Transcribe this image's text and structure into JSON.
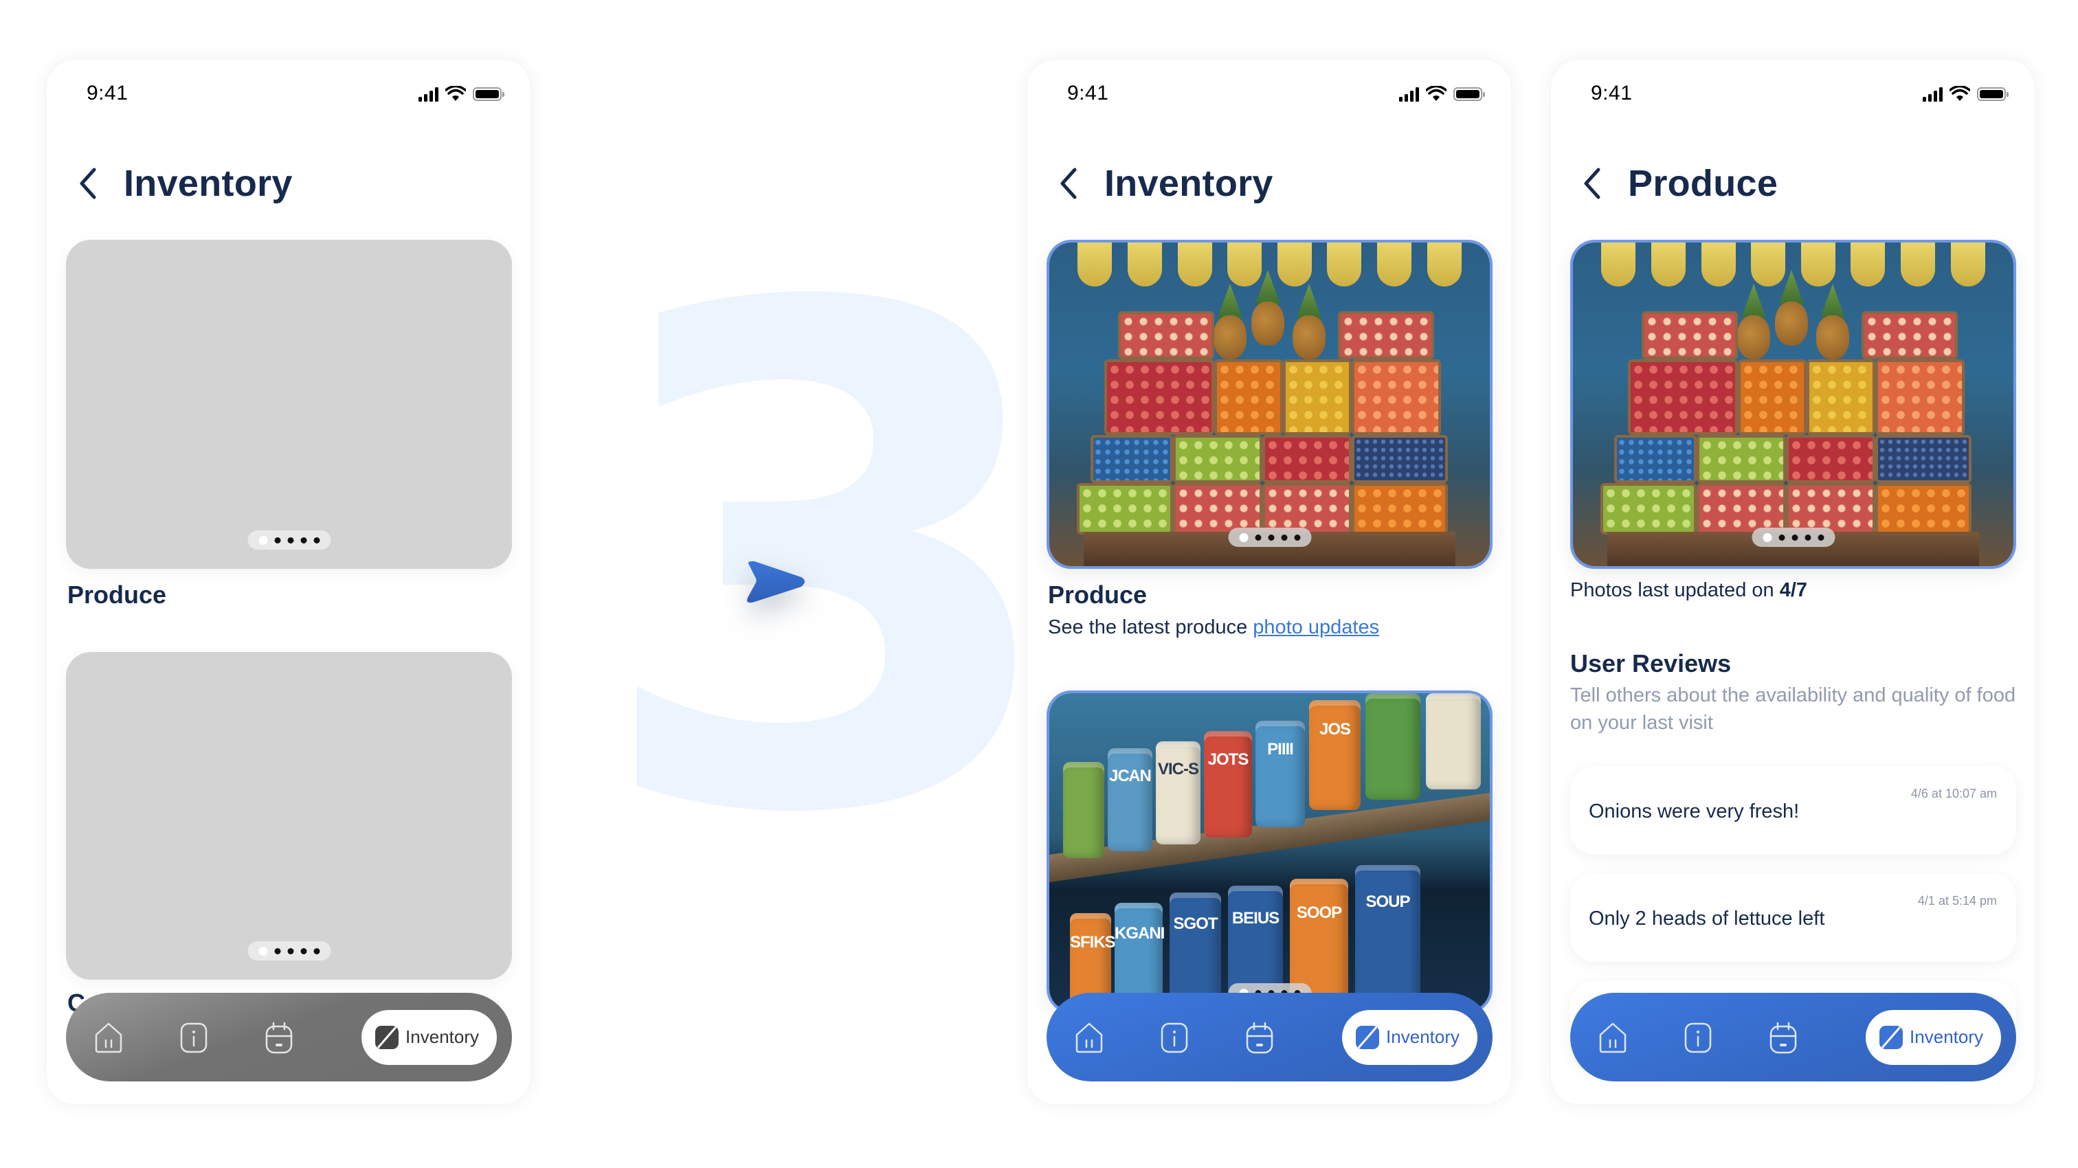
{
  "step_number": "3",
  "colors": {
    "primary_blue": "#3b77db",
    "title_navy": "#172a4d",
    "muted_text": "#909bb0",
    "placeholder_gray": "#d3d3d3",
    "step_number_tint": "#ecf4fd"
  },
  "status_bar": {
    "time": "9:41"
  },
  "screen_wireframe": {
    "header": {
      "back_icon": "chevron-left-icon",
      "title": "Inventory"
    },
    "cards": [
      {
        "title": "Produce",
        "carousel": {
          "total": 5,
          "active": 1
        }
      },
      {
        "title": "C",
        "carousel": {
          "total": 5,
          "active": 1
        }
      }
    ],
    "nav": {
      "items": [
        {
          "icon": "home-icon",
          "label": "Home"
        },
        {
          "icon": "info-icon",
          "label": "Info"
        },
        {
          "icon": "calendar-icon",
          "label": "Calendar"
        }
      ],
      "active": {
        "icon": "inventory-icon",
        "label": "Inventory"
      }
    }
  },
  "screen_inventory": {
    "header": {
      "back_icon": "chevron-left-icon",
      "title": "Inventory"
    },
    "cards": [
      {
        "title": "Produce",
        "subtitle_prefix": "See the latest produce ",
        "subtitle_link": "photo updates",
        "image": "fruit-market-stand-photo",
        "carousel": {
          "total": 5,
          "active": 1
        }
      },
      {
        "image": "canned-goods-shelf-photo",
        "can_labels": [
          "ЈСАN",
          "VIC-S",
          "JOTS",
          "PIIII",
          "JOS",
          "SFIKS",
          "KGANI",
          "SGOT",
          "BEIUS",
          "SOOP",
          "SOUP"
        ],
        "carousel": {
          "total": 5,
          "active": 1
        }
      }
    ],
    "nav": {
      "items": [
        {
          "icon": "home-icon",
          "label": "Home"
        },
        {
          "icon": "info-icon",
          "label": "Info"
        },
        {
          "icon": "calendar-icon",
          "label": "Calendar"
        }
      ],
      "active": {
        "icon": "inventory-icon",
        "label": "Inventory"
      }
    }
  },
  "screen_produce": {
    "header": {
      "back_icon": "chevron-left-icon",
      "title": "Produce"
    },
    "image": "fruit-market-stand-photo",
    "carousel": {
      "total": 5,
      "active": 1
    },
    "updated_prefix": "Photos last updated on ",
    "updated_date": "4/7",
    "reviews_title": "User Reviews",
    "reviews_desc": "Tell others about the availability and quality of food on your last visit",
    "reviews": [
      {
        "text": "Onions were very fresh!",
        "time": "4/6 at 10:07 am"
      },
      {
        "text": "Only 2 heads of lettuce left",
        "time": "4/1 at 5:14 pm"
      },
      {
        "text": "",
        "time": ""
      }
    ],
    "nav": {
      "items": [
        {
          "icon": "home-icon",
          "label": "Home"
        },
        {
          "icon": "info-icon",
          "label": "Info"
        },
        {
          "icon": "calendar-icon",
          "label": "Calendar"
        }
      ],
      "active": {
        "icon": "inventory-icon",
        "label": "Inventory"
      }
    }
  }
}
